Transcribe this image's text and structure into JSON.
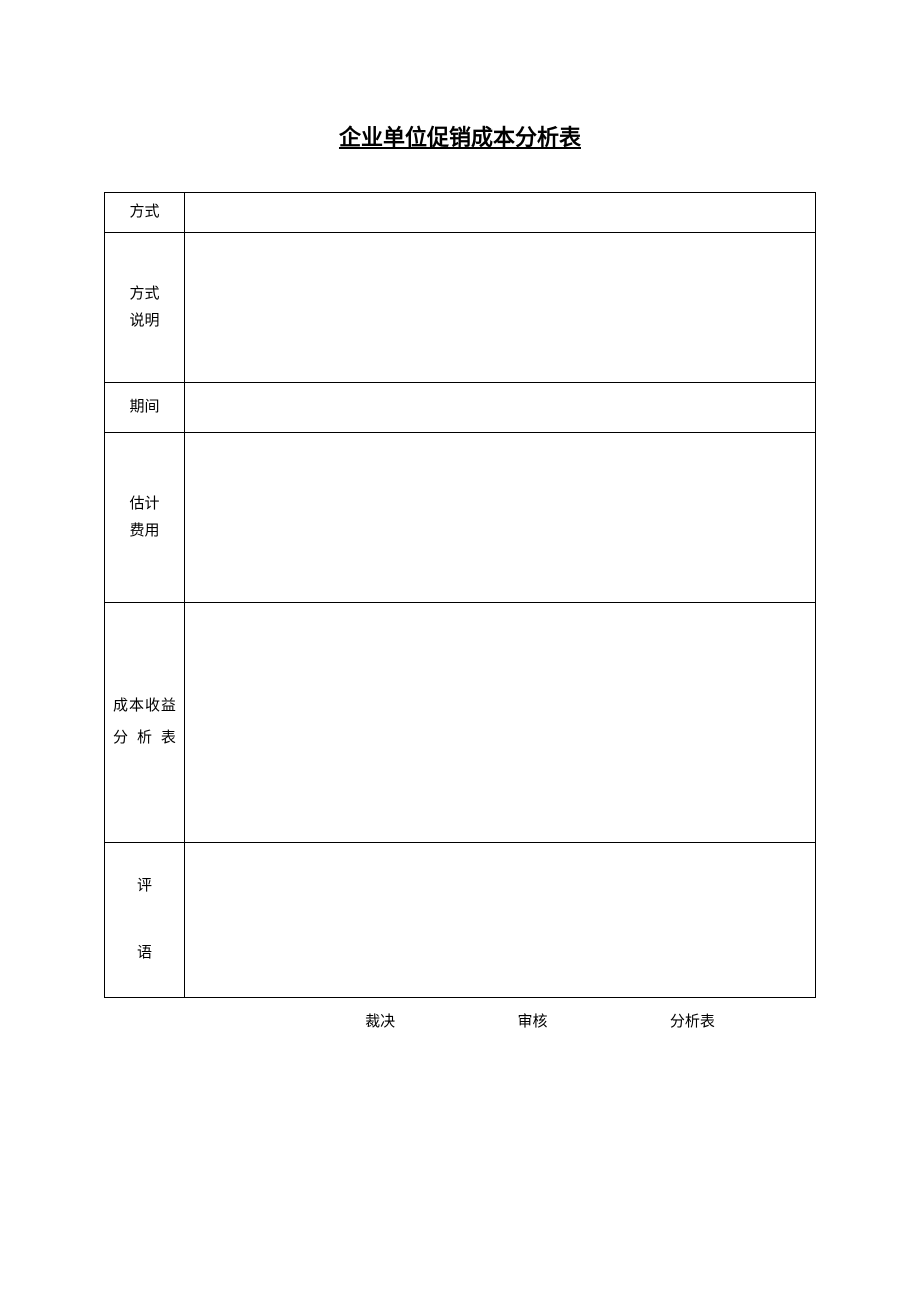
{
  "title": "企业单位促销成本分析表",
  "rows": {
    "method": {
      "label": "方式",
      "value": ""
    },
    "method_desc": {
      "label_line1": "方式",
      "label_line2": "说明",
      "value": ""
    },
    "period": {
      "label": "期间",
      "value": ""
    },
    "estimated_cost": {
      "label_line1": "估计",
      "label_line2": "费用",
      "value": ""
    },
    "cost_benefit": {
      "label": "成本收益分析表",
      "value": ""
    },
    "comment": {
      "label_line1": "评",
      "label_line2": "语",
      "value": ""
    }
  },
  "footer": {
    "decision": "裁决",
    "review": "审核",
    "analysis": "分析表"
  }
}
